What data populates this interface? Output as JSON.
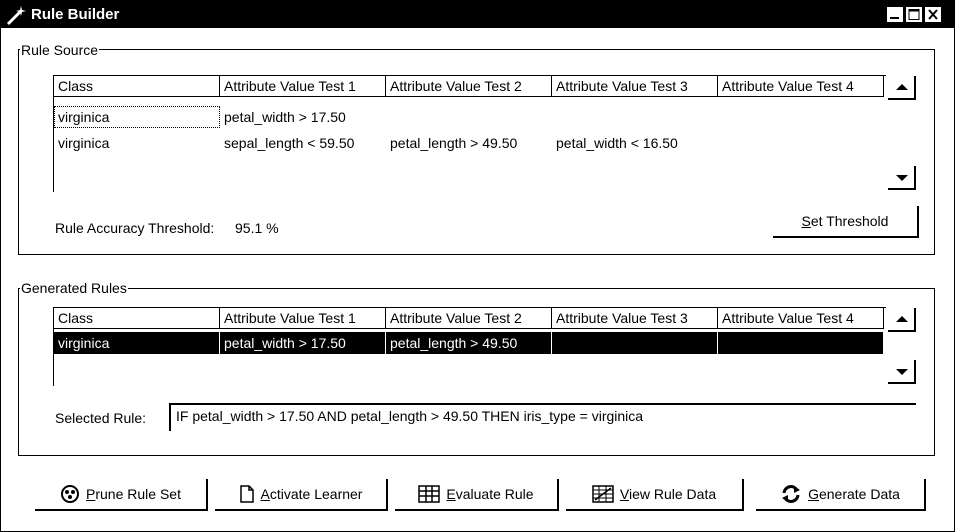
{
  "window": {
    "title": "Rule Builder"
  },
  "rule_source": {
    "label": "Rule Source",
    "columns": [
      "Class",
      "Attribute Value Test 1",
      "Attribute Value Test 2",
      "Attribute Value Test 3",
      "Attribute Value Test 4"
    ],
    "rows": [
      [
        "virginica",
        "petal_width > 17.50",
        "",
        "",
        ""
      ],
      [
        "virginica",
        "sepal_length < 59.50",
        "petal_length > 49.50",
        "petal_width < 16.50",
        ""
      ]
    ],
    "threshold_label": "Rule Accuracy Threshold:",
    "threshold_value": "95.1 %",
    "set_threshold_mnemonic": "S",
    "set_threshold_rest": "et Threshold"
  },
  "generated_rules": {
    "label": "Generated Rules",
    "columns": [
      "Class",
      "Attribute Value Test 1",
      "Attribute Value Test 2",
      "Attribute Value Test 3",
      "Attribute Value Test 4"
    ],
    "rows": [
      [
        "virginica",
        "petal_width > 17.50",
        "petal_length > 49.50",
        "",
        ""
      ]
    ],
    "selected_rule_label": "Selected Rule:",
    "selected_rule_value": "IF petal_width > 17.50 AND petal_length > 49.50 THEN iris_type = virginica"
  },
  "buttons": {
    "prune": {
      "mnemonic": "P",
      "rest": "rune Rule Set"
    },
    "activate": {
      "mnemonic": "A",
      "rest": "ctivate Learner"
    },
    "evaluate": {
      "mnemonic": "E",
      "rest": "valuate Rule"
    },
    "view": {
      "mnemonic": "V",
      "rest": "iew Rule Data"
    },
    "generate": {
      "mnemonic": "G",
      "rest": "enerate Data"
    }
  },
  "colors": {
    "selection_bg": "#000000",
    "selection_fg": "#ffffff"
  }
}
